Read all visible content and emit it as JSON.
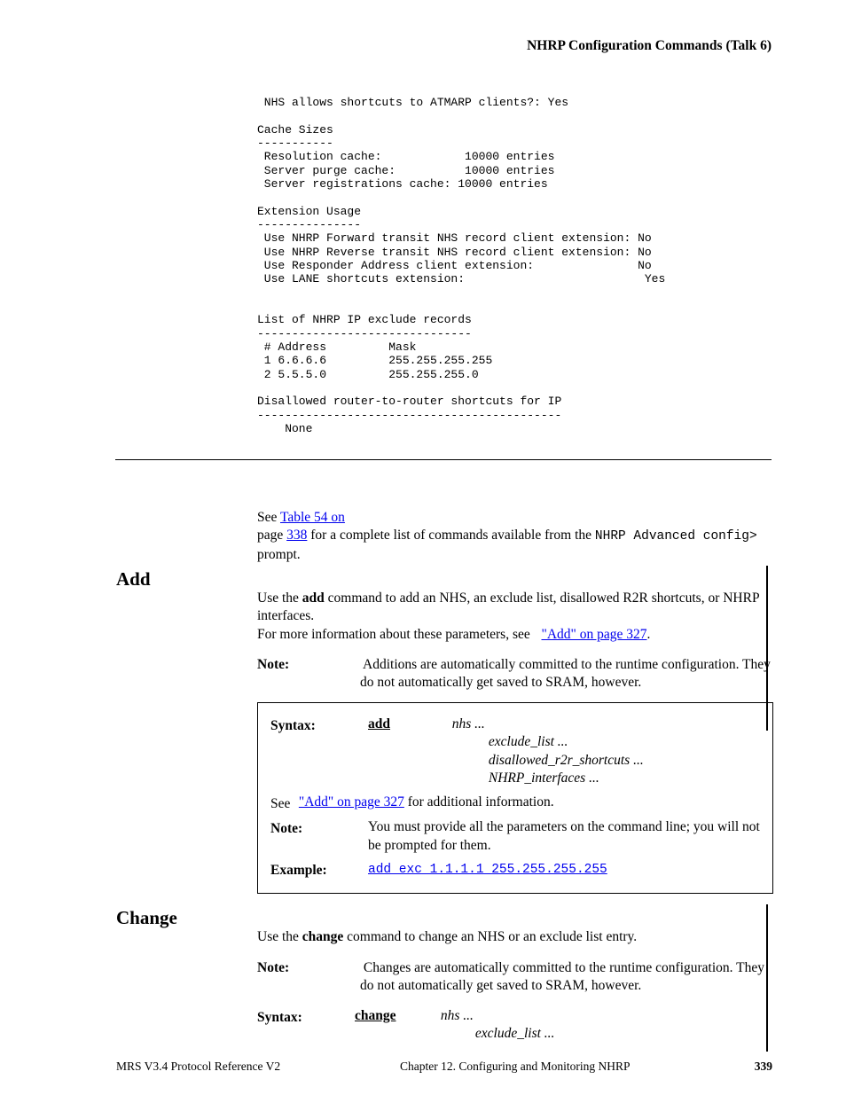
{
  "running_head": "NHRP Configuration Commands (Talk 6)",
  "terminal_block": " NHS allows shortcuts to ATMARP clients?: Yes\n\nCache Sizes\n-----------\n Resolution cache:            10000 entries\n Server purge cache:          10000 entries\n Server registrations cache: 10000 entries\n\nExtension Usage\n---------------\n Use NHRP Forward transit NHS record client extension: No\n Use NHRP Reverse transit NHS record client extension: No\n Use Responder Address client extension:               No\n Use LANE shortcuts extension:                          Yes\n\n\nList of NHRP IP exclude records\n-------------------------------\n # Address         Mask\n 1 6.6.6.6         255.255.255.255\n 2 5.5.5.0         255.255.255.0\n\nDisallowed router-to-router shortcuts for IP\n--------------------------------------------\n    None",
  "add_heading": "Add",
  "add_para": {
    "pre": "Use the ",
    "cmd": "add",
    "mid": " command to add an NHS, an exclude list, disallowed R2R shortcuts, or NHRP interfaces.",
    "about_intro": "For more information about these parameters, see",
    "link2": "\"Add\" on page 327",
    "after": "."
  },
  "note_label": "Note:",
  "note_text": " Additions are automatically committed to the runtime configuration. They do not automatically get saved to SRAM, however.",
  "syntax": {
    "label_syntax": "Syntax:",
    "cmd": "add",
    "opt1": "nhs ...",
    "opt2": "exclude_list ...",
    "opt3": "disallowed_r2r_shortcuts ...",
    "opt4": "NHRP_interfaces ...",
    "label_see": "See",
    "see_link": "\"Add\" on page 327",
    "see_after": " for additional information.",
    "label_note": "Note:",
    "note_text": " You must provide all the parameters on the command line; you will not be prompted for them.",
    "label_example": "Example:",
    "ex_link": "add exc 1.1.1.1 255.255.255.255"
  },
  "change_heading": "Change",
  "change_text_pre": "Use the ",
  "change_cmd": "change",
  "change_text_post": " command to change an NHS or an exclude list entry.",
  "change_note_label": "Note:",
  "change_note_text": " Changes are automatically committed to the runtime configuration. They do not automatically get saved to SRAM, however.",
  "syntax2": {
    "label": "Syntax:",
    "cmd": "change",
    "opt1": "nhs ...",
    "opt2": "exclude_list ..."
  },
  "footer_left": "MRS V3.4 Protocol Reference V2",
  "footer_center": "Chapter 12. Configuring and Monitoring NHRP",
  "footer_page": "339",
  "link1_text": " See ",
  "link1_link": "Table 54 on",
  "link1_page_pre": "page ",
  "link1_page": "338",
  "link1_tail": " for a complete list of commands available from the ",
  "link1_prompt": "NHRP Advanced config>",
  "link1_end": " prompt."
}
